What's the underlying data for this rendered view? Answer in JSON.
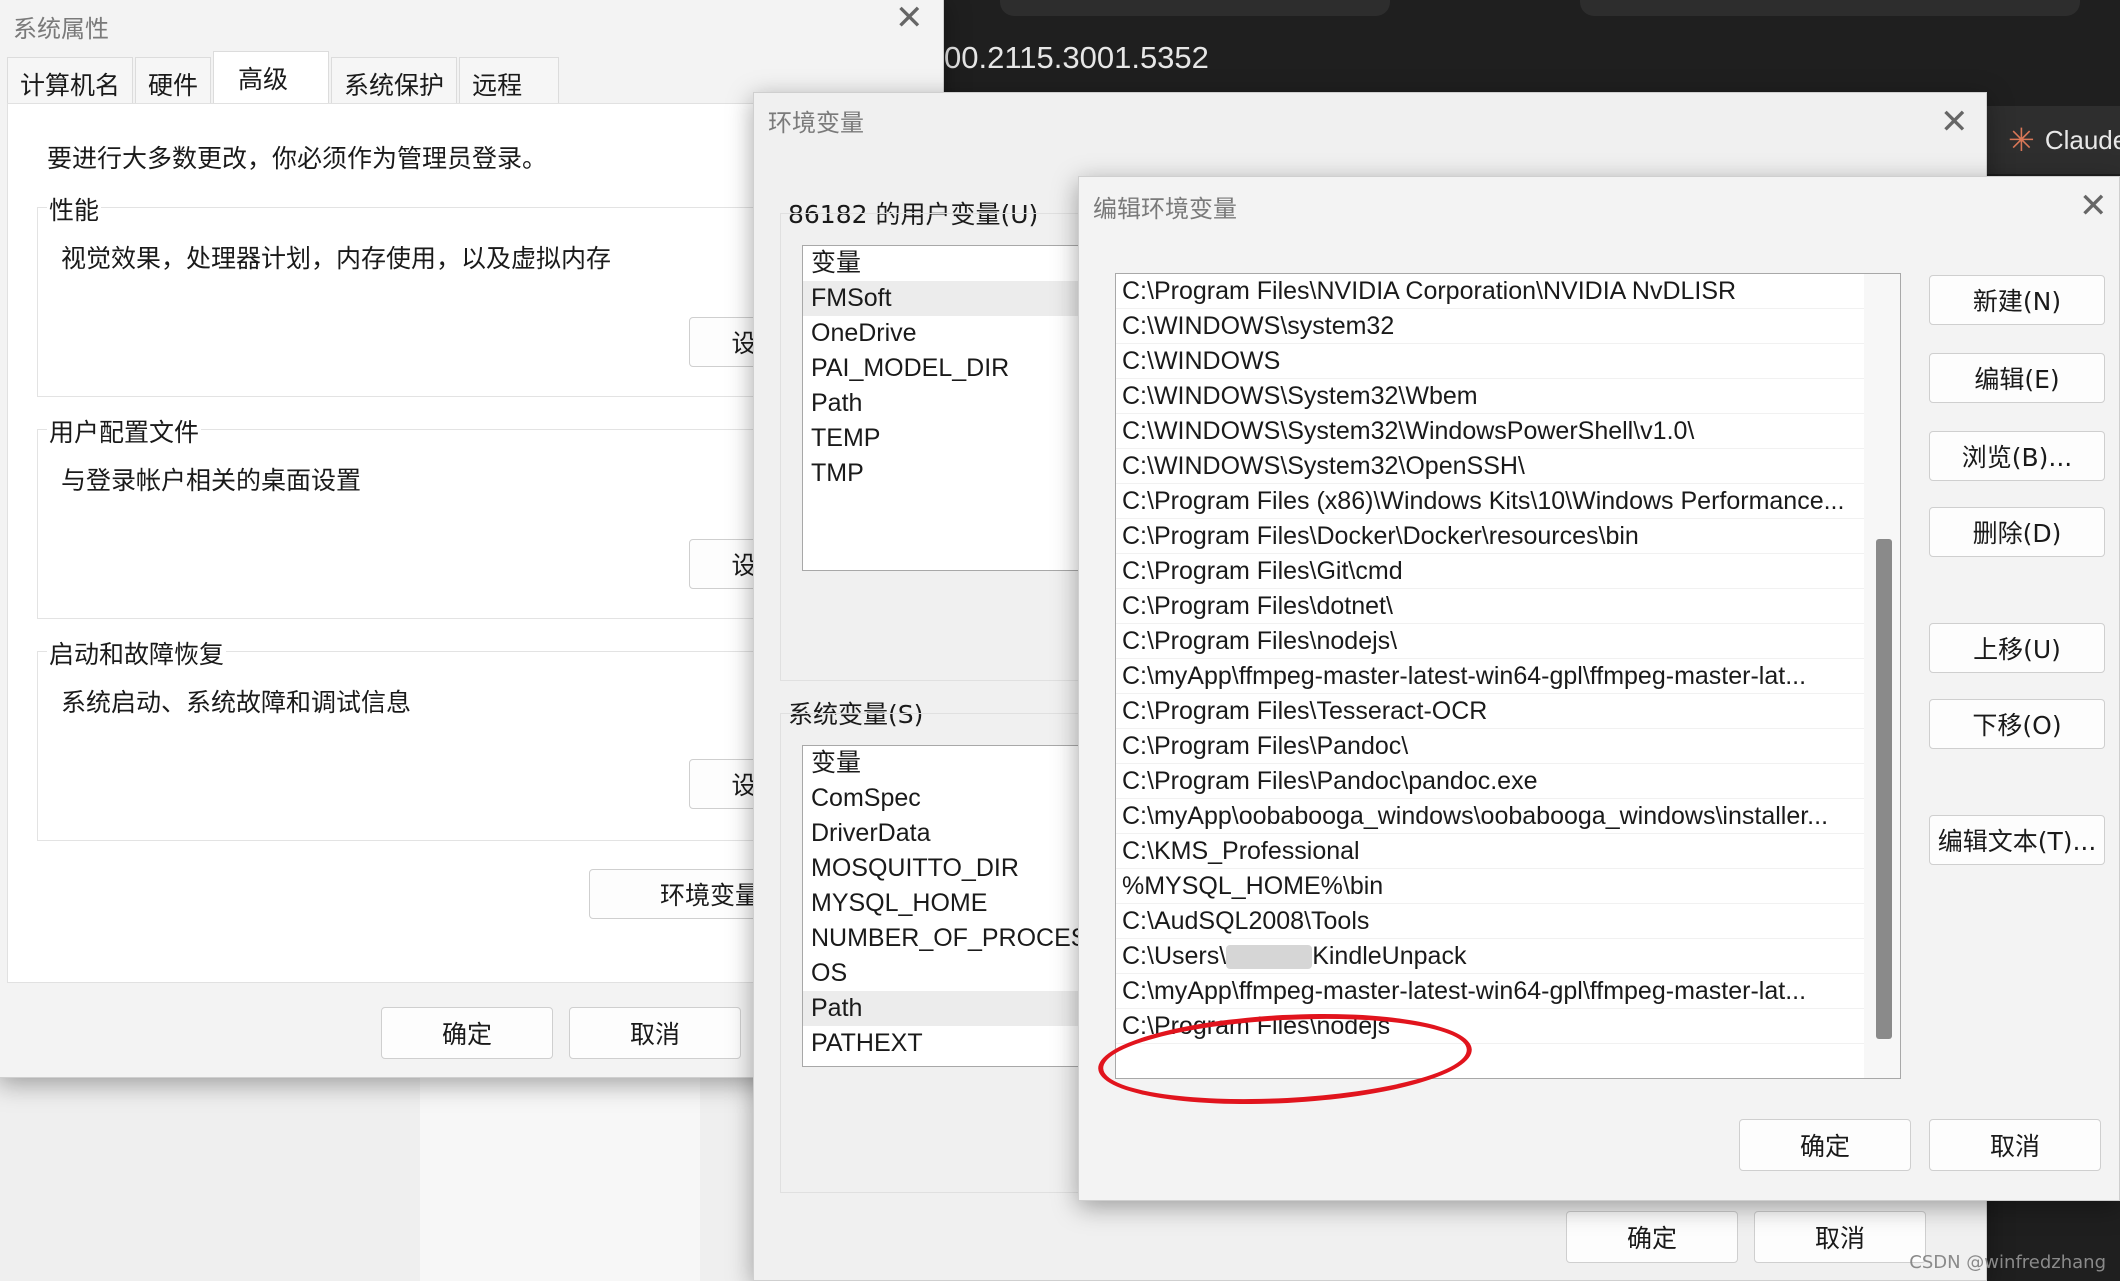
{
  "background": {
    "version_text": "00.2115.3001.5352",
    "claude_tab_label": "Claude",
    "watermark": "CSDN @winfredzhang"
  },
  "system_properties": {
    "title": "系统属性",
    "tabs": [
      "计算机名",
      "硬件",
      "高级",
      "系统保护",
      "远程"
    ],
    "active_tab": "高级",
    "admin_note": "要进行大多数更改，你必须作为管理员登录。",
    "performance": {
      "legend": "性能",
      "description": "视觉效果，处理器计划，内存使用，以及虚拟内存",
      "button": "设"
    },
    "user_profiles": {
      "legend": "用户配置文件",
      "description": "与登录帐户相关的桌面设置",
      "button": "设"
    },
    "startup_recovery": {
      "legend": "启动和故障恢复",
      "description": "系统启动、系统故障和调试信息",
      "button": "设"
    },
    "env_button": "环境变量",
    "ok": "确定",
    "cancel": "取消"
  },
  "env_window": {
    "title": "环境变量",
    "user_section_label": "86182 的用户变量(U)",
    "user_header": "变量",
    "user_vars": [
      "FMSoft",
      "OneDrive",
      "PAI_MODEL_DIR",
      "Path",
      "TEMP",
      "TMP"
    ],
    "user_selected": "FMSoft",
    "system_section_label": "系统变量(S)",
    "system_header": "变量",
    "system_vars": [
      "ComSpec",
      "DriverData",
      "MOSQUITTO_DIR",
      "MYSQL_HOME",
      "NUMBER_OF_PROCESS",
      "OS",
      "Path",
      "PATHEXT"
    ],
    "system_selected": "Path",
    "ok": "确定",
    "cancel": "取消"
  },
  "edit_dialog": {
    "title": "编辑环境变量",
    "paths": [
      "C:\\Program Files\\NVIDIA Corporation\\NVIDIA NvDLISR",
      "C:\\WINDOWS\\system32",
      "C:\\WINDOWS",
      "C:\\WINDOWS\\System32\\Wbem",
      "C:\\WINDOWS\\System32\\WindowsPowerShell\\v1.0\\",
      "C:\\WINDOWS\\System32\\OpenSSH\\",
      "C:\\Program Files (x86)\\Windows Kits\\10\\Windows Performance...",
      "C:\\Program Files\\Docker\\Docker\\resources\\bin",
      "C:\\Program Files\\Git\\cmd",
      "C:\\Program Files\\dotnet\\",
      "C:\\Program Files\\nodejs\\",
      "C:\\myApp\\ffmpeg-master-latest-win64-gpl\\ffmpeg-master-lat...",
      "C:\\Program Files\\Tesseract-OCR",
      "C:\\Program Files\\Pandoc\\",
      "C:\\Program Files\\Pandoc\\pandoc.exe",
      "C:\\myApp\\oobabooga_windows\\oobabooga_windows\\installer...",
      "C:\\KMS_Professional",
      "%MYSQL_HOME%\\bin",
      "C:\\AudSQL2008\\Tools"
    ],
    "redacted_path_prefix": "C:\\Users\\",
    "redacted_path_suffix": "KindleUnpack",
    "paths_after": [
      "C:\\myApp\\ffmpeg-master-latest-win64-gpl\\ffmpeg-master-lat...",
      "C:\\Program Files\\nodejs"
    ],
    "scroll_position": 0.5,
    "buttons": {
      "new": "新建(N)",
      "edit": "编辑(E)",
      "browse": "浏览(B)...",
      "delete": "删除(D)",
      "move_up": "上移(U)",
      "move_down": "下移(O)",
      "edit_text": "编辑文本(T)..."
    },
    "ok": "确定",
    "cancel": "取消",
    "annotation_color": "#e1141d"
  }
}
